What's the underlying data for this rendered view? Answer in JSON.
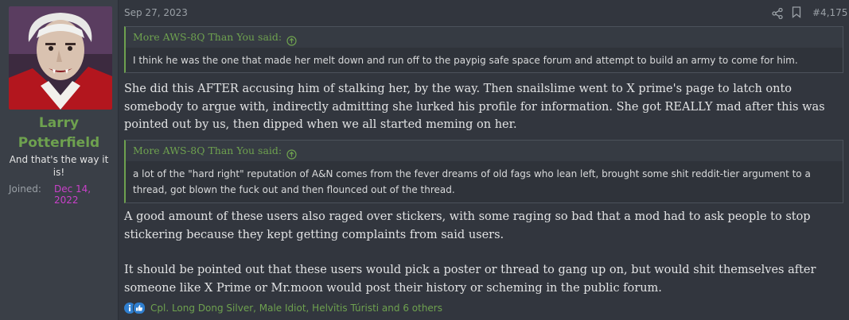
{
  "user": {
    "name_line1": "Larry",
    "name_line2": "Potterfield",
    "title": "And that's the way it is!",
    "joined_label": "Joined:",
    "joined_value": "Dec 14, 2022"
  },
  "post": {
    "date": "Sep 27, 2023",
    "number": "#4,175",
    "quote1": {
      "author": "More AWS-8Q Than You said:",
      "text": "I think he was the one that made her melt down and run off to the paypig safe space forum and attempt to build an army to come for him."
    },
    "paragraph1": "She did this AFTER accusing him of stalking her, by the way. Then snailslime went to X prime's page to latch onto somebody to argue with, indirectly admitting she lurked his profile for information. She got REALLY mad after this was pointed out by us, then dipped when we all started meming on her.",
    "quote2": {
      "author": "More AWS-8Q Than You said:",
      "text": "a lot of the \"hard right\" reputation of A&N comes from the fever dreams of old fags who lean left, brought some shit reddit-tier argument to a thread, got blown the fuck out and then flounced out of the thread."
    },
    "paragraph2": "A good amount of these users also raged over stickers, with some raging so bad that a mod had to ask people to stop stickering because they kept getting complaints from said users.",
    "paragraph3": "It should be pointed out that these users would pick a poster or thread to gang up on, but would shit themselves after someone like X Prime or Mr.moon would post their history or scheming in the public forum.",
    "reactions": "Cpl. Long Dong Silver, Male Idiot, Helvītis Túristi and 6 others"
  },
  "icons": {
    "share": "share-icon",
    "bookmark": "bookmark-icon",
    "quote_arrow": "arrow-up-circle-icon",
    "reaction_info": "info-reaction-icon",
    "reaction_like": "like-reaction-icon"
  },
  "colors": {
    "accent_green": "#6ea14f",
    "joined_date": "#c940c9",
    "background": "#32363e",
    "user_cell": "#3a3f47"
  }
}
